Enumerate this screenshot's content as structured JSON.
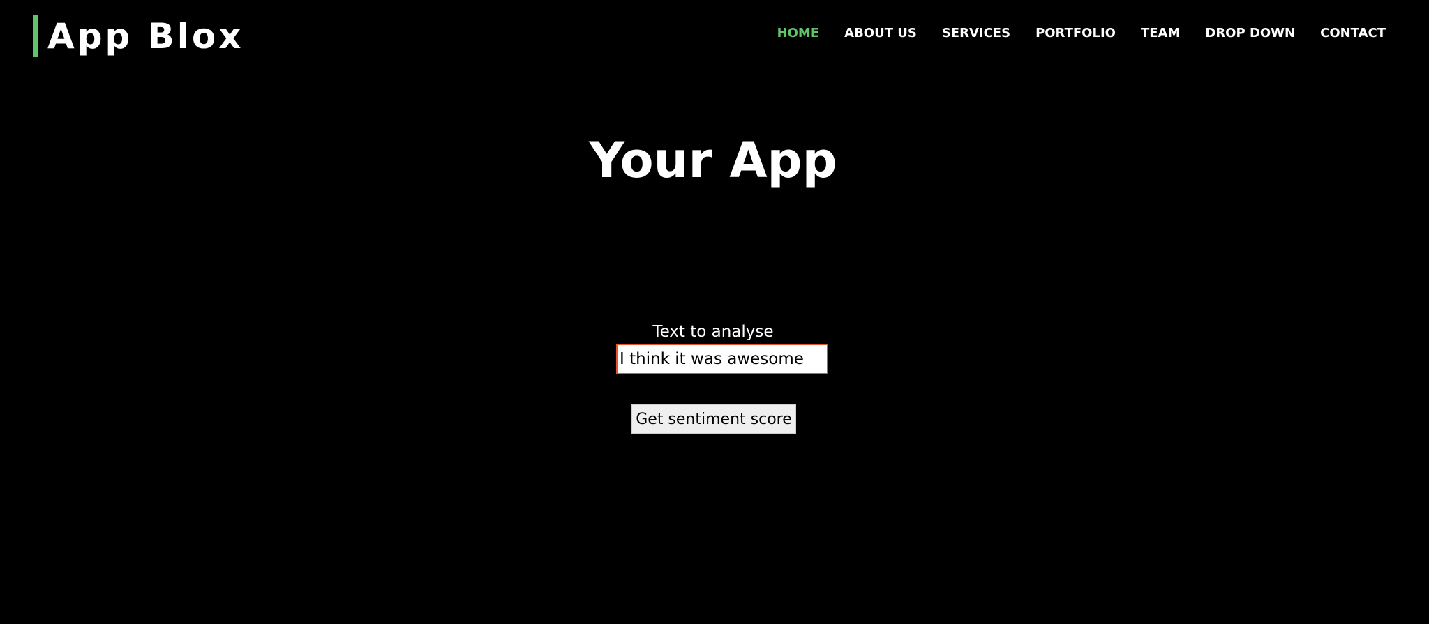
{
  "header": {
    "brand": "App Blox",
    "nav": [
      {
        "label": "HOME",
        "active": true
      },
      {
        "label": "ABOUT US",
        "active": false
      },
      {
        "label": "SERVICES",
        "active": false
      },
      {
        "label": "PORTFOLIO",
        "active": false
      },
      {
        "label": "TEAM",
        "active": false
      },
      {
        "label": "DROP DOWN",
        "active": false
      },
      {
        "label": "CONTACT",
        "active": false
      }
    ]
  },
  "hero": {
    "title": "Your App"
  },
  "form": {
    "label": "Text to analyse",
    "input_value": "I think it was awesome",
    "button_label": "Get sentiment score"
  },
  "colors": {
    "background": "#000000",
    "accent": "#5fc46b",
    "input_border": "#e0562f",
    "text": "#ffffff"
  }
}
